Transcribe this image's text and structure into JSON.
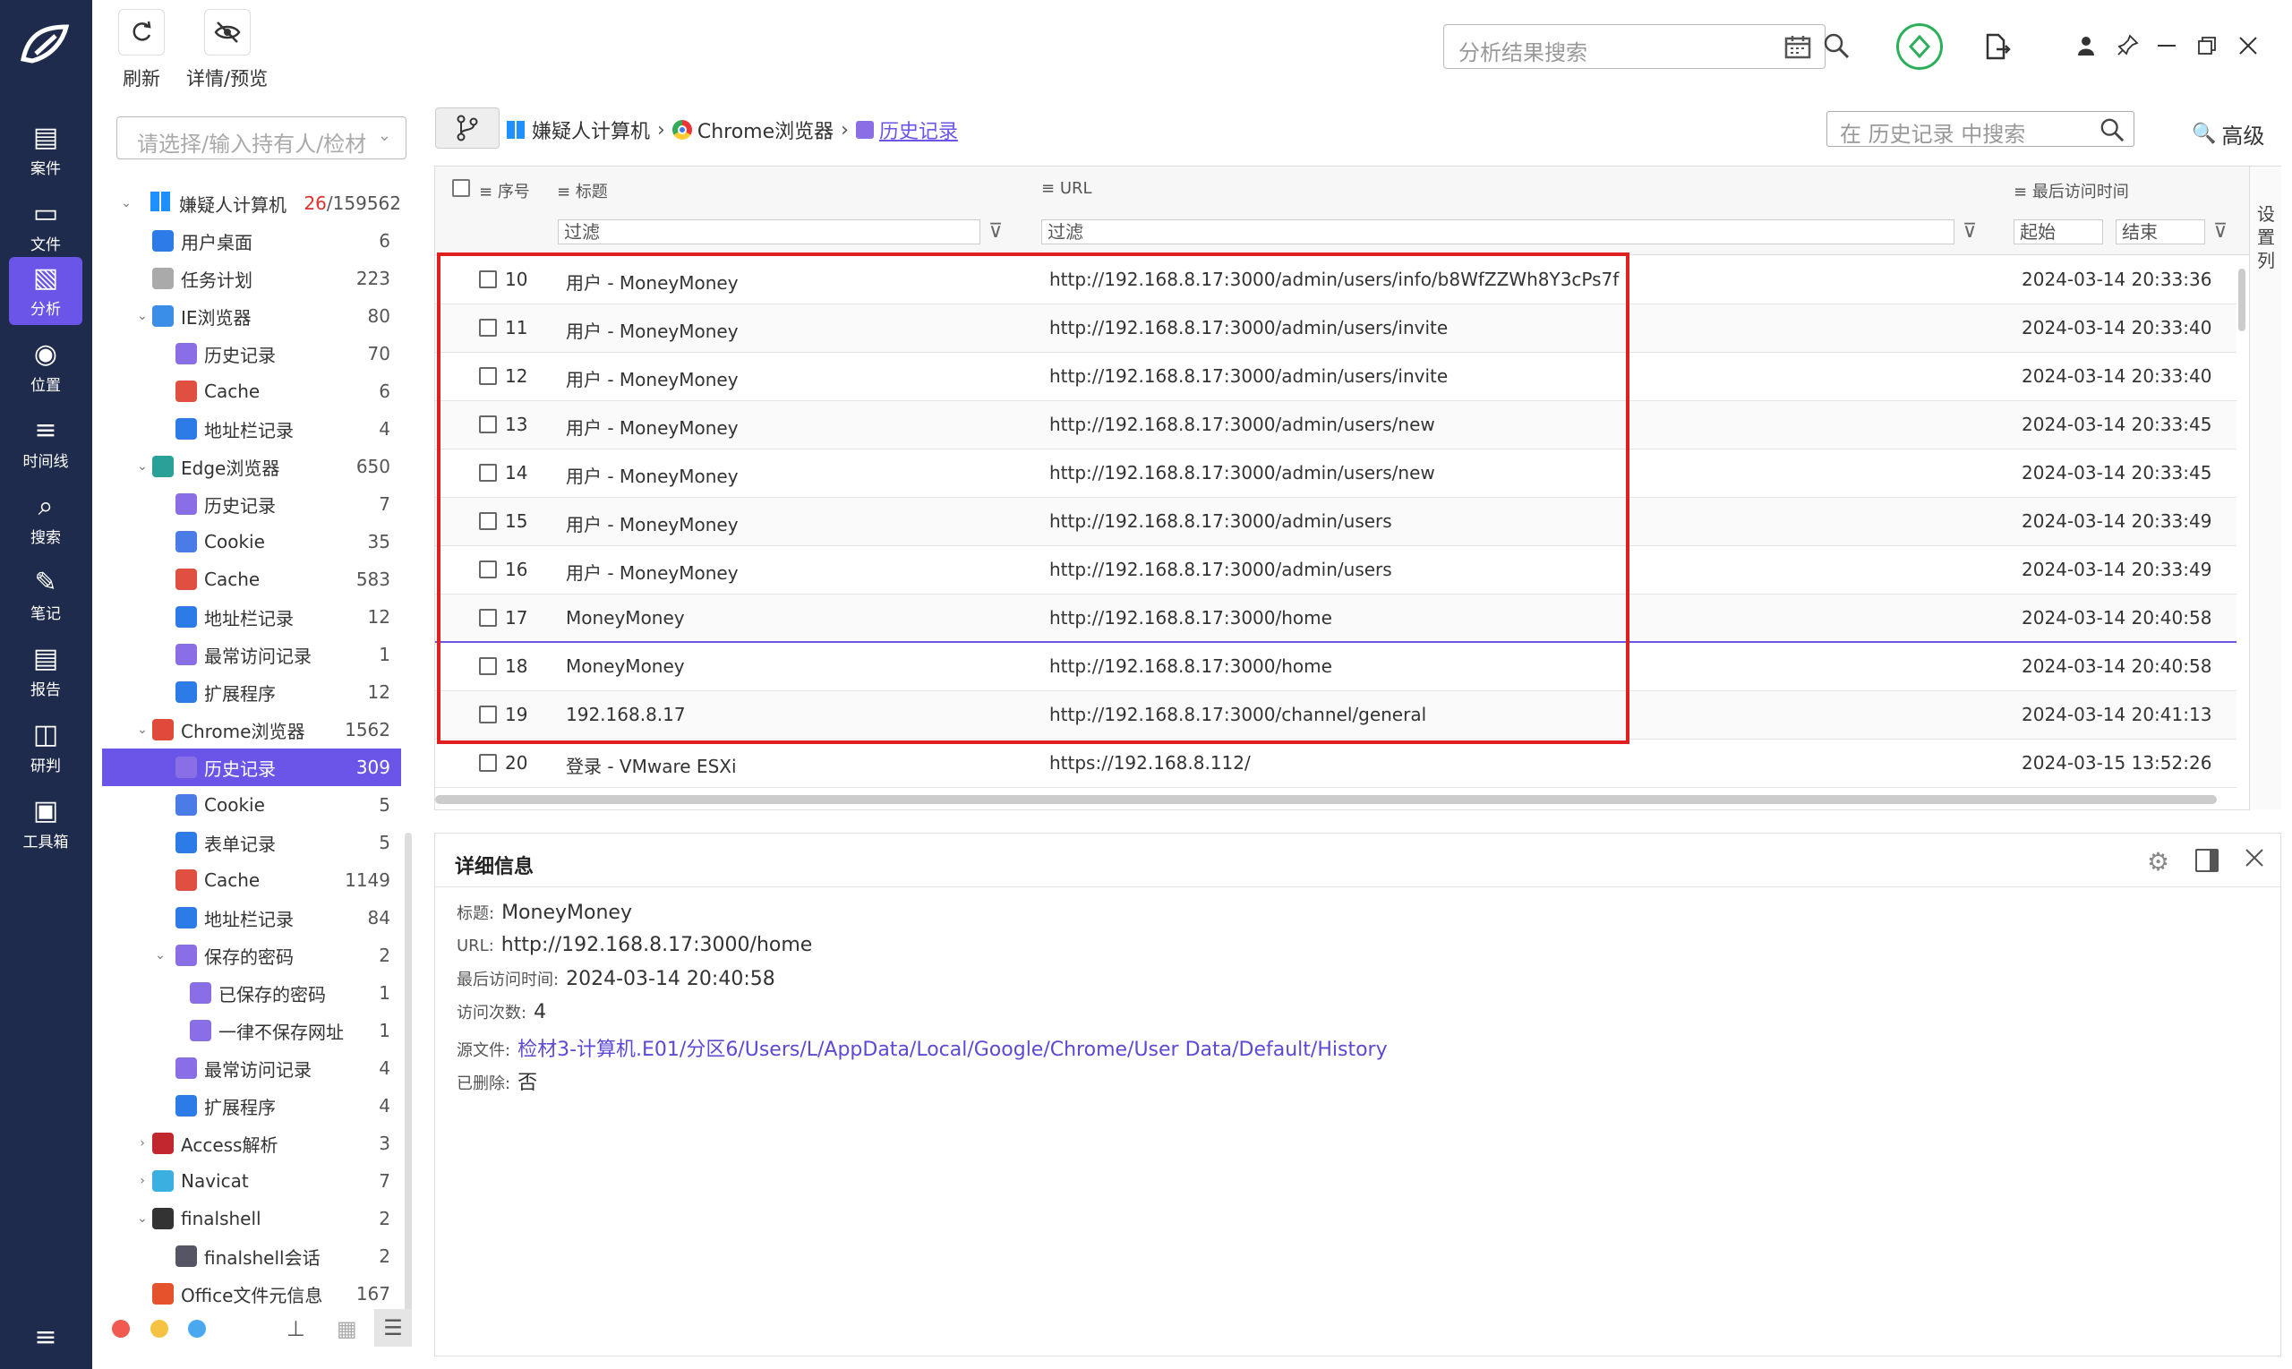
{
  "rail": {
    "items": [
      {
        "label": "案件",
        "icon": "case-icon"
      },
      {
        "label": "文件",
        "icon": "file-icon"
      },
      {
        "label": "分析",
        "icon": "analysis-icon",
        "active": true
      },
      {
        "label": "位置",
        "icon": "location-icon"
      },
      {
        "label": "时间线",
        "icon": "timeline-icon"
      },
      {
        "label": "搜索",
        "icon": "search-icon"
      },
      {
        "label": "笔记",
        "icon": "note-icon"
      },
      {
        "label": "报告",
        "icon": "report-icon"
      },
      {
        "label": "研判",
        "icon": "judge-icon"
      },
      {
        "label": "工具箱",
        "icon": "toolbox-icon"
      }
    ]
  },
  "toolbar": {
    "refresh_label": "刷新",
    "preview_label": "详情/预览"
  },
  "top": {
    "search_placeholder": "分析结果搜索"
  },
  "tree": {
    "search_placeholder": "请选择/输入持有人/检材",
    "root": {
      "label": "嫌疑人计算机",
      "count_hit": "26",
      "count_total": "/159562"
    },
    "items": [
      {
        "label": "用户桌面",
        "count": "6"
      },
      {
        "label": "任务计划",
        "count": "223"
      },
      {
        "label": "IE浏览器",
        "count": "80"
      },
      {
        "label": "历史记录",
        "count": "70"
      },
      {
        "label": "Cache",
        "count": "6"
      },
      {
        "label": "地址栏记录",
        "count": "4"
      },
      {
        "label": "Edge浏览器",
        "count": "650"
      },
      {
        "label": "历史记录",
        "count": "7"
      },
      {
        "label": "Cookie",
        "count": "35"
      },
      {
        "label": "Cache",
        "count": "583"
      },
      {
        "label": "地址栏记录",
        "count": "12"
      },
      {
        "label": "最常访问记录",
        "count": "1"
      },
      {
        "label": "扩展程序",
        "count": "12"
      },
      {
        "label": "Chrome浏览器",
        "count": "1562"
      },
      {
        "label": "历史记录",
        "count": "309"
      },
      {
        "label": "Cookie",
        "count": "5"
      },
      {
        "label": "表单记录",
        "count": "5"
      },
      {
        "label": "Cache",
        "count": "1149"
      },
      {
        "label": "地址栏记录",
        "count": "84"
      },
      {
        "label": "保存的密码",
        "count": "2"
      },
      {
        "label": "已保存的密码",
        "count": "1"
      },
      {
        "label": "一律不保存网址",
        "count": "1"
      },
      {
        "label": "最常访问记录",
        "count": "4"
      },
      {
        "label": "扩展程序",
        "count": "4"
      },
      {
        "label": "Access解析",
        "count": "3"
      },
      {
        "label": "Navicat",
        "count": "7"
      },
      {
        "label": "finalshell",
        "count": "2"
      },
      {
        "label": "finalshell会话",
        "count": "2"
      },
      {
        "label": "Office文件元信息",
        "count": "167"
      }
    ]
  },
  "breadcrumb": {
    "a": "嫌疑人计算机",
    "b": "Chrome浏览器",
    "c": "历史记录"
  },
  "gridsearch": {
    "placeholder": "在 历史记录 中搜索",
    "advanced": "高级"
  },
  "grid": {
    "headers": {
      "seq": "序号",
      "title": "标题",
      "url": "URL",
      "time": "最后访问时间"
    },
    "filters": {
      "title": "过滤",
      "url": "过滤",
      "start": "起始",
      "end": "结束"
    },
    "side_label": "设置列",
    "rows": [
      {
        "seq": "10",
        "title": "用户 - MoneyMoney",
        "url": "http://192.168.8.17:3000/admin/users/info/b8WfZZWh8Y3cPs7f",
        "time": "2024-03-14 20:33:36"
      },
      {
        "seq": "11",
        "title": "用户 - MoneyMoney",
        "url": "http://192.168.8.17:3000/admin/users/invite",
        "time": "2024-03-14 20:33:40"
      },
      {
        "seq": "12",
        "title": "用户 - MoneyMoney",
        "url": "http://192.168.8.17:3000/admin/users/invite",
        "time": "2024-03-14 20:33:40"
      },
      {
        "seq": "13",
        "title": "用户 - MoneyMoney",
        "url": "http://192.168.8.17:3000/admin/users/new",
        "time": "2024-03-14 20:33:45"
      },
      {
        "seq": "14",
        "title": "用户 - MoneyMoney",
        "url": "http://192.168.8.17:3000/admin/users/new",
        "time": "2024-03-14 20:33:45"
      },
      {
        "seq": "15",
        "title": "用户 - MoneyMoney",
        "url": "http://192.168.8.17:3000/admin/users",
        "time": "2024-03-14 20:33:49"
      },
      {
        "seq": "16",
        "title": "用户 - MoneyMoney",
        "url": "http://192.168.8.17:3000/admin/users",
        "time": "2024-03-14 20:33:49"
      },
      {
        "seq": "17",
        "title": "MoneyMoney",
        "url": "http://192.168.8.17:3000/home",
        "time": "2024-03-14 20:40:58"
      },
      {
        "seq": "18",
        "title": "MoneyMoney",
        "url": "http://192.168.8.17:3000/home",
        "time": "2024-03-14 20:40:58"
      },
      {
        "seq": "19",
        "title": "192.168.8.17",
        "url": "http://192.168.8.17:3000/channel/general",
        "time": "2024-03-14 20:41:13"
      },
      {
        "seq": "20",
        "title": "登录 - VMware ESXi",
        "url": "https://192.168.8.112/",
        "time": "2024-03-15 13:52:26"
      }
    ]
  },
  "detail": {
    "heading": "详细信息",
    "title_label": "标题:",
    "title_value": "MoneyMoney",
    "url_label": "URL:",
    "url_value": "http://192.168.8.17:3000/home",
    "time_label": "最后访问时间:",
    "time_value": "2024-03-14 20:40:58",
    "visits_label": "访问次数:",
    "visits_value": "4",
    "source_label": "源文件:",
    "source_value": "检材3-计算机.E01/分区6/Users/L/AppData/Local/Google/Chrome/User Data/Default/History",
    "deleted_label": "已删除:",
    "deleted_value": "否"
  },
  "colors": {
    "rail": "#1f2b4d",
    "accent": "#6a55e8",
    "highlight": "#e02020",
    "source_link": "#5b4ad4"
  }
}
